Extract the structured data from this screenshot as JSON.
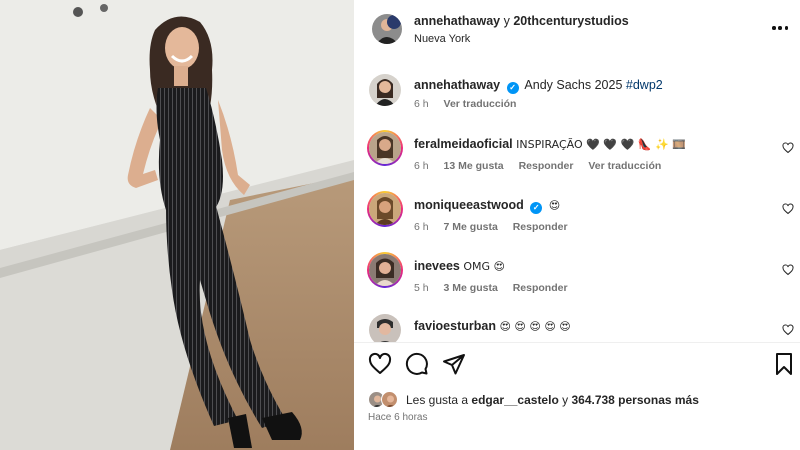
{
  "header": {
    "user1": "annehathaway",
    "conjunction": "y",
    "user2": "20thcenturystudios",
    "location": "Nueva York"
  },
  "caption": {
    "user": "annehathaway",
    "text": "Andy Sachs 2025",
    "hashtag": "#dwp2",
    "time": "6 h",
    "translate": "Ver traducción"
  },
  "comments": [
    {
      "user": "feralmeidaoficial",
      "text": "INSPIRAÇÃO 🖤 🖤 🖤 👠 ✨ 🎞️",
      "time": "6 h",
      "likes": "13 Me gusta",
      "reply": "Responder",
      "translate": "Ver traducción",
      "verified": false
    },
    {
      "user": "moniqueeastwood",
      "text": "😍",
      "time": "6 h",
      "likes": "7 Me gusta",
      "reply": "Responder",
      "verified": true
    },
    {
      "user": "inevees",
      "text": "OMG 😍",
      "time": "5 h",
      "likes": "3 Me gusta",
      "reply": "Responder",
      "verified": false
    },
    {
      "user": "favioesturban",
      "text": "😍 😍 😍 😍 😍",
      "verified": false
    }
  ],
  "likes": {
    "prefix": "Les gusta a",
    "user": "edgar__castelo",
    "connector": "y",
    "count": "364.738 personas más"
  },
  "timestamp": "Hace 6 horas",
  "icons": {
    "more": "more-options-icon",
    "like": "heart-icon",
    "comment": "comment-icon",
    "share": "share-icon",
    "save": "bookmark-icon"
  },
  "colors": {
    "verified": "#0095f6",
    "hashtag": "#00376b",
    "meta": "#737373"
  }
}
